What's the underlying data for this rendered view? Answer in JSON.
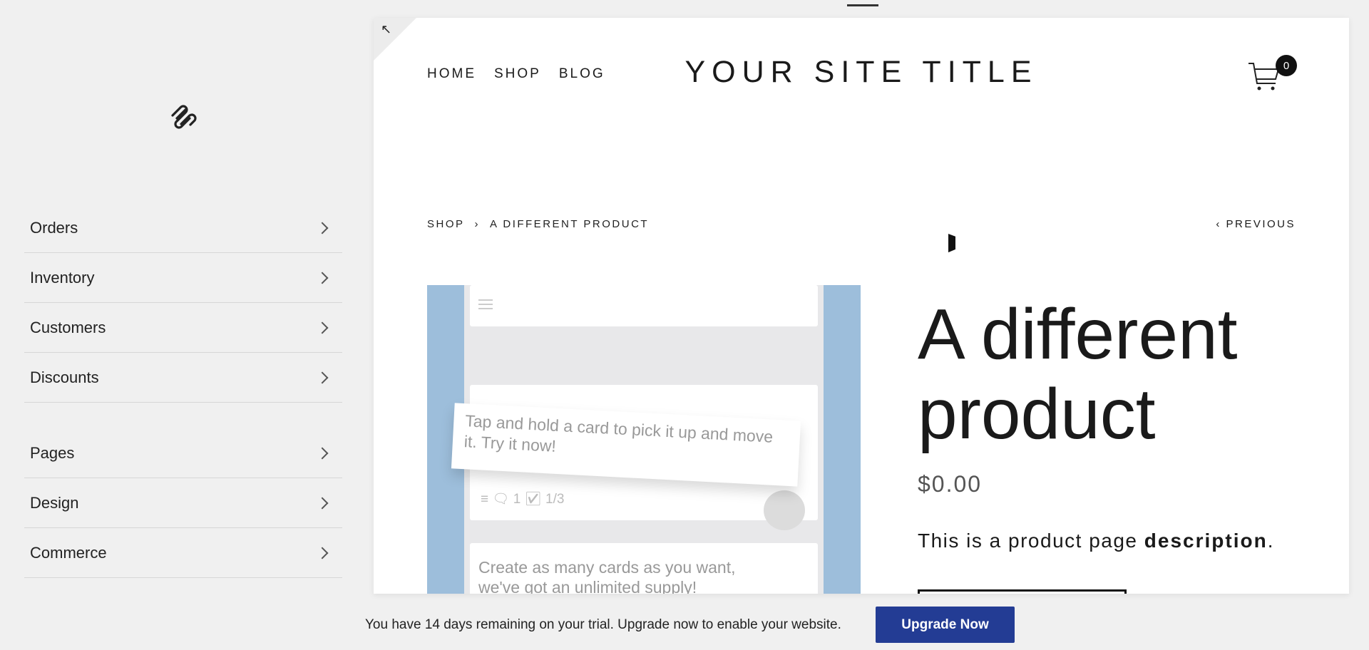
{
  "sidebar": {
    "groups": [
      {
        "items": [
          {
            "label": "Orders"
          },
          {
            "label": "Inventory"
          },
          {
            "label": "Customers"
          },
          {
            "label": "Discounts"
          }
        ]
      },
      {
        "items": [
          {
            "label": "Pages"
          },
          {
            "label": "Design"
          },
          {
            "label": "Commerce"
          }
        ]
      }
    ]
  },
  "site": {
    "nav": [
      "HOME",
      "SHOP",
      "BLOG"
    ],
    "title": "YOUR SITE TITLE",
    "cart_count": "0",
    "breadcrumb": {
      "shop": "SHOP",
      "separator": "›",
      "current": "A DIFFERENT PRODUCT"
    },
    "previous": "‹ PREVIOUS",
    "image": {
      "tip": "Tap and hold a card to pick it up and move it. Try it now!",
      "comments": "1",
      "checklist": "1/3",
      "create": "Create as many cards as you want, we've got an unlimited supply!"
    },
    "product": {
      "title": "A different product",
      "price": "$0.00",
      "desc_pre": "This is a product page ",
      "desc_bold": "description",
      "desc_post": "."
    }
  },
  "banner": {
    "text": "You have 14 days remaining on your trial. Upgrade now to enable your website.",
    "button": "Upgrade Now",
    "button_color": "#233c94"
  }
}
